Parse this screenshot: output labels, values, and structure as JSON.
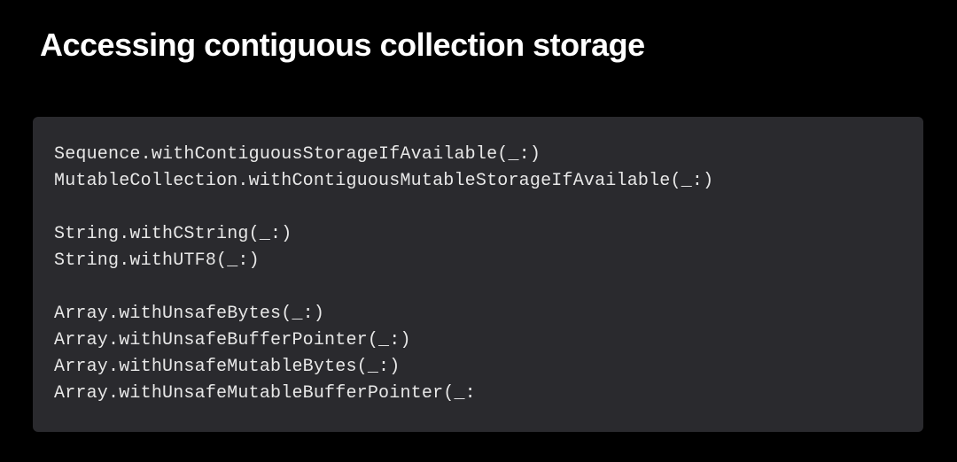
{
  "title": "Accessing contiguous collection storage",
  "code": {
    "group1": {
      "line1": "Sequence.withContiguousStorageIfAvailable(_:)",
      "line2": "MutableCollection.withContiguousMutableStorageIfAvailable(_:)"
    },
    "group2": {
      "line1": "String.withCString(_:)",
      "line2": "String.withUTF8(_:)"
    },
    "group3": {
      "line1": "Array.withUnsafeBytes(_:)",
      "line2": "Array.withUnsafeBufferPointer(_:)",
      "line3": "Array.withUnsafeMutableBytes(_:)",
      "line4": "Array.withUnsafeMutableBufferPointer(_:"
    }
  }
}
